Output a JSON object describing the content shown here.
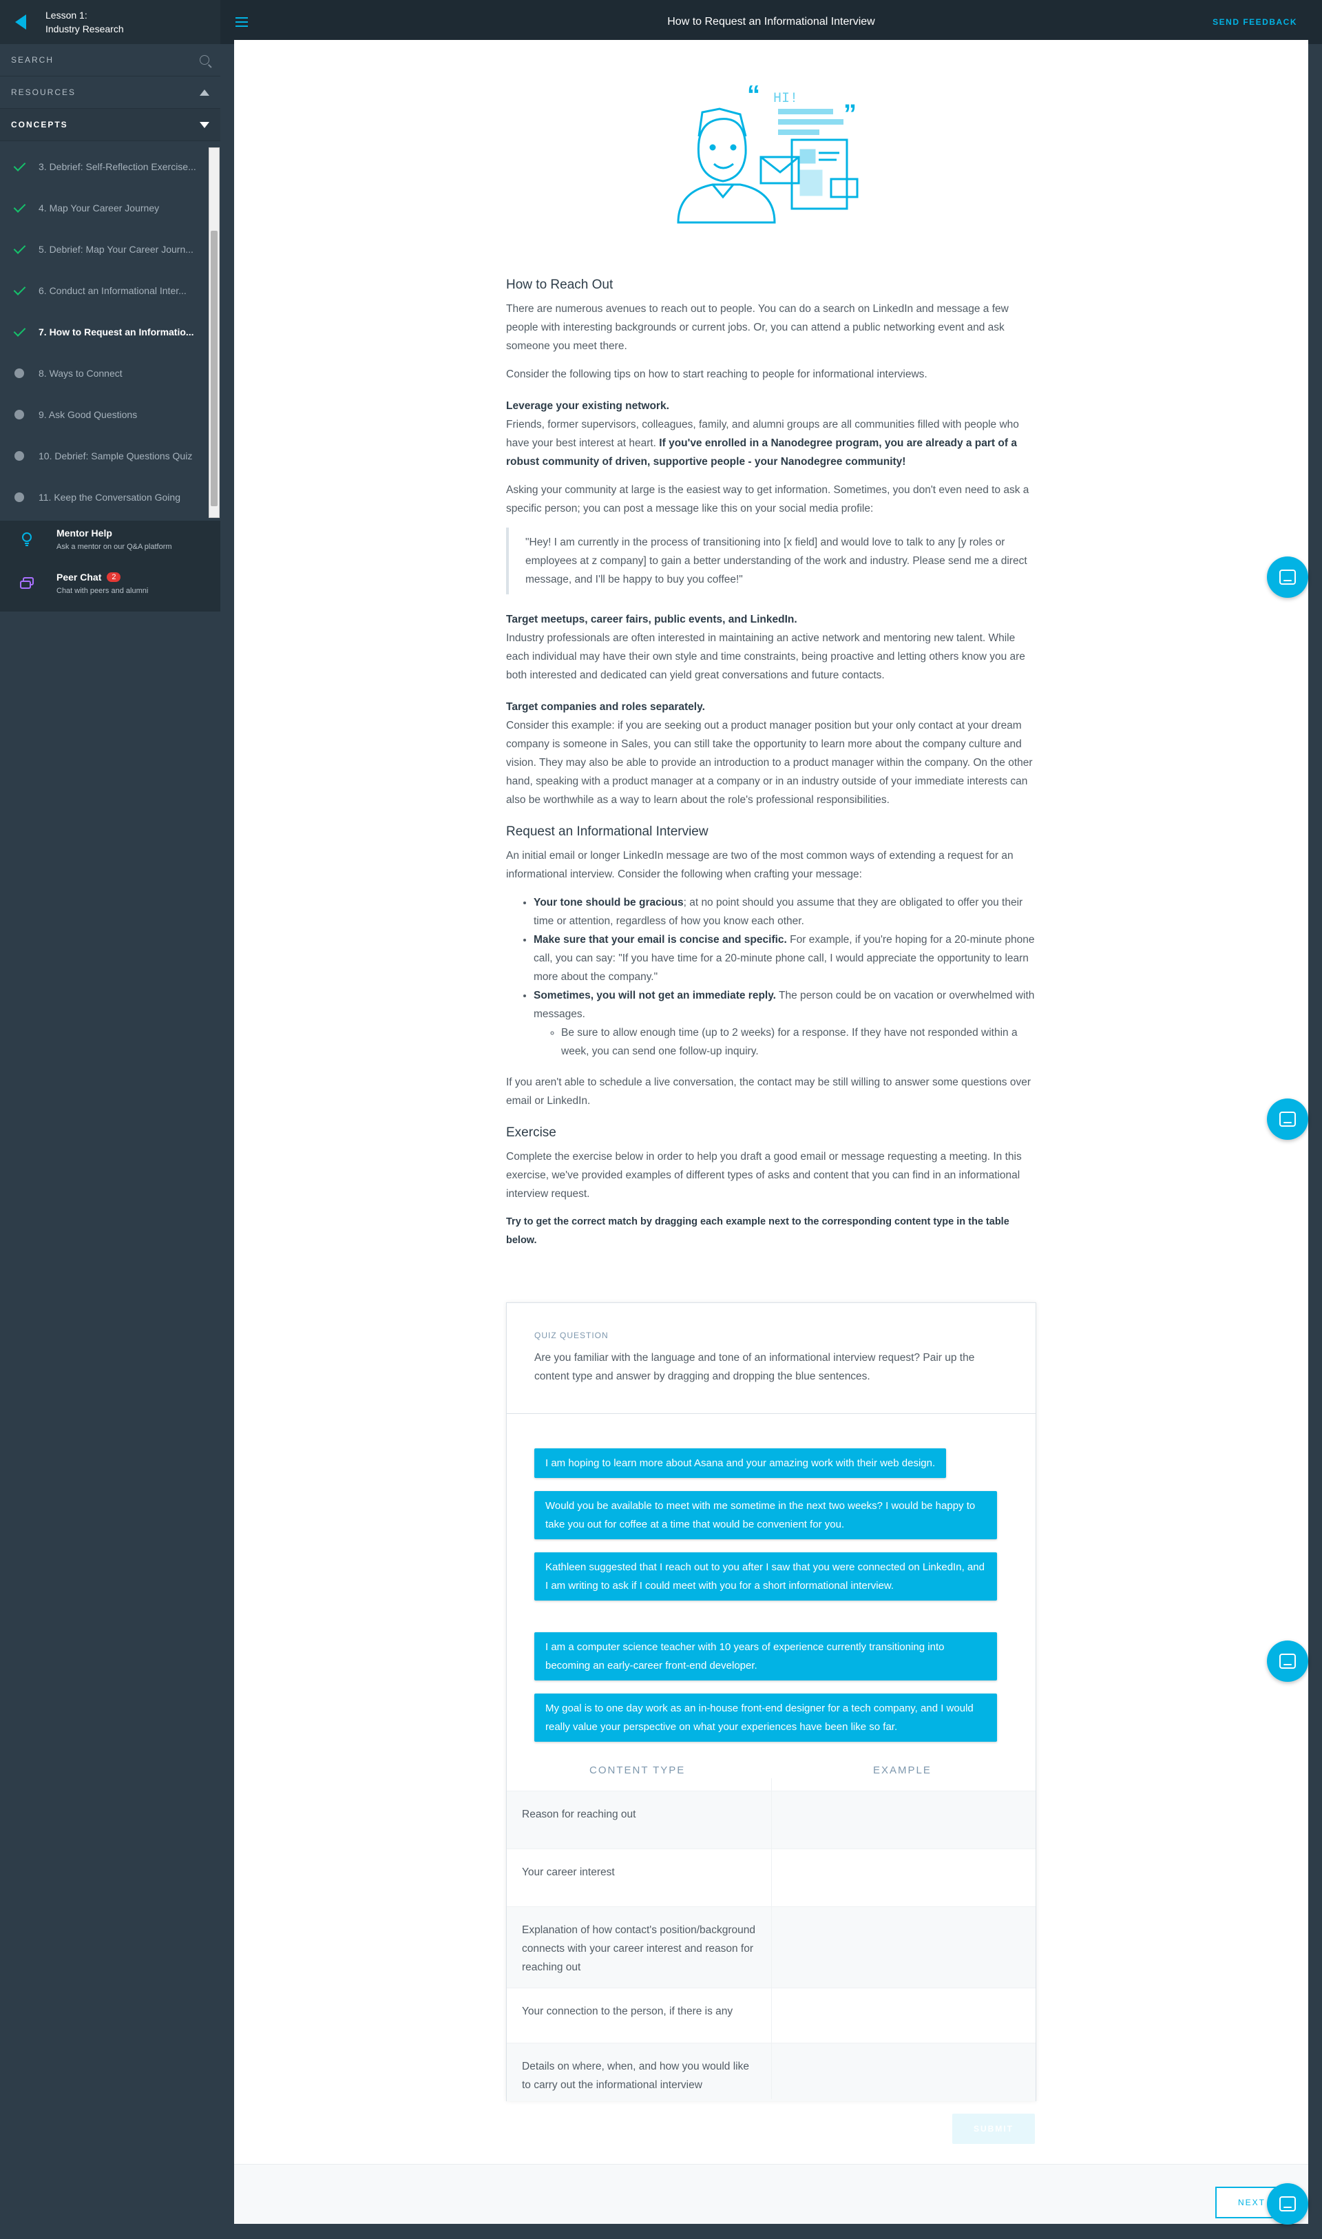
{
  "sidebar": {
    "lesson_title_line1": "Lesson 1:",
    "lesson_title_line2": "Industry Research",
    "search_label": "SEARCH",
    "resources_label": "RESOURCES",
    "concepts_label": "CONCEPTS",
    "items": [
      {
        "label": "3. Debrief: Self-Reflection Exercise...",
        "status": "done"
      },
      {
        "label": "4. Map Your Career Journey",
        "status": "done"
      },
      {
        "label": "5. Debrief: Map Your Career Journ...",
        "status": "done"
      },
      {
        "label": "6. Conduct an Informational Inter...",
        "status": "done"
      },
      {
        "label": "7. How to Request an Informatio...",
        "status": "active"
      },
      {
        "label": "8. Ways to Connect",
        "status": "todo"
      },
      {
        "label": "9. Ask Good Questions",
        "status": "todo"
      },
      {
        "label": "10. Debrief: Sample Questions Quiz",
        "status": "todo"
      },
      {
        "label": "11. Keep the Conversation Going",
        "status": "todo"
      }
    ],
    "mentor_help": {
      "title": "Mentor Help",
      "subtitle": "Ask a mentor on our Q&A platform"
    },
    "peer_chat": {
      "title": "Peer Chat",
      "badge": "2",
      "subtitle": "Chat with peers and alumni"
    }
  },
  "topbar": {
    "title": "How to Request an Informational Interview",
    "feedback": "SEND FEEDBACK"
  },
  "illustration": {
    "bubble_text": "HI!"
  },
  "article": {
    "h_reach": "How to Reach Out",
    "p_reach": "There are numerous avenues to reach out to people. You can do a search on LinkedIn and message a few people with interesting backgrounds or current jobs. Or, you can attend a public networking event and ask someone you meet there.",
    "p_tips": "Consider the following tips on how to start reaching to people for informational interviews.",
    "lead_network": "Leverage your existing network.",
    "p_network": "Friends, former supervisors, colleagues, family, and alumni groups are all communities filled with people who have your best interest at heart. ",
    "p_network_bold": "If you've enrolled in a Nanodegree program, you are already a part of a robust community of driven, supportive people - your Nanodegree community!",
    "p_community": "Asking your community at large is the easiest way to get information. Sometimes, you don't even need to ask a specific person; you can post a message like this on your social media profile:",
    "quote": "\"Hey! I am currently in the process of transitioning into [x field] and would love to talk to any [y roles or employees at z company] to gain a better understanding of the work and industry. Please send me a direct message, and I'll be happy to buy you coffee!\"",
    "lead_meetups": "Target meetups, career fairs, public events, and LinkedIn.",
    "p_meetups": "Industry professionals are often interested in maintaining an active network and mentoring new talent. While each individual may have their own style and time constraints, being proactive and letting others know you are both interested and dedicated can yield great conversations and future contacts.",
    "lead_companies": "Target companies and roles separately.",
    "p_companies": "Consider this example: if you are seeking out a product manager position but your only contact at your dream company is someone in Sales, you can still take the opportunity to learn more about the company culture and vision. They may also be able to provide an introduction to a product manager within the company. On the other hand, speaking with a product manager at a company or in an industry outside of your immediate interests can also be worthwhile as a way to learn about the role's professional responsibilities.",
    "h_request": "Request an Informational Interview",
    "p_request": "An initial email or longer LinkedIn message are two of the most common ways of extending a request for an informational interview. Consider the following when crafting your message:",
    "b1_bold": "Your tone should be gracious",
    "b1_rest": "; at no point should you assume that they are obligated to offer you their time or attention, regardless of how you know each other.",
    "b2_bold": "Make sure that your email is concise and specific.",
    "b2_rest": " For example, if you're hoping for a 20-minute phone call, you can say: \"If you have time for a 20-minute phone call, I would appreciate the opportunity to learn more about the company.\"",
    "b3_bold": "Sometimes, you will not get an immediate reply.",
    "b3_rest": " The person could be on vacation or overwhelmed with messages.",
    "b3_sub": "Be sure to allow enough time (up to 2 weeks) for a response. If they have not responded within a week, you can send one follow-up inquiry.",
    "p_live": "If you aren't able to schedule a live conversation, the contact may be still willing to answer some questions over email or LinkedIn.",
    "h_exercise": "Exercise",
    "p_exercise": "Complete the exercise below in order to help you draft a good email or message requesting a meeting. In this exercise, we've provided examples of different types of asks and content that you can find in an informational interview request.",
    "p_instruction": "Try to get the correct match by dragging each example next to the corresponding content type in the table below."
  },
  "quiz": {
    "label": "QUIZ QUESTION",
    "question": "Are you familiar with the language and tone of an informational interview request? Pair up the content type and answer by dragging and dropping the blue sentences.",
    "options": [
      "I am hoping to learn more about Asana and your amazing work with their web design.",
      "Would you be available to meet with me sometime in the next two weeks? I would be happy to take you out for coffee at a time that would be convenient for you.",
      "Kathleen suggested that I reach out to you after I saw that you were connected on LinkedIn, and I am writing to ask if I could meet with you for a short informational interview.",
      "I am a computer science teacher with 10 years of experience currently transitioning into becoming an early-career front-end developer.",
      "My goal is to one day work as an in-house front-end designer for a tech company, and I would really value your perspective on what your experiences have been like so far."
    ],
    "col_content": "CONTENT TYPE",
    "col_example": "EXAMPLE",
    "rows": [
      "Reason for reaching out",
      "Your career interest",
      "Explanation of how contact's position/background connects with your career interest and reason for reaching out",
      "Your connection to the person, if there is any",
      "Details on where, when, and how you would like to carry out the informational interview"
    ],
    "submit": "SUBMIT"
  },
  "footer": {
    "next": "NEXT"
  },
  "colors": {
    "accent": "#02b3e4",
    "done": "#15c26b",
    "sidebar": "#2e3d49"
  }
}
